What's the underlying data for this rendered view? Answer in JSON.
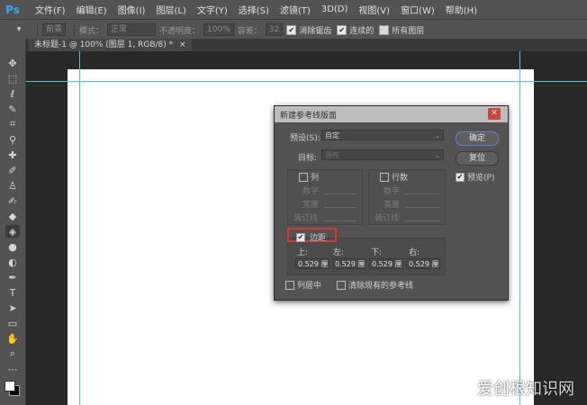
{
  "app": {
    "logo": "Ps"
  },
  "menu": {
    "items": [
      "文件(F)",
      "编辑(E)",
      "图像(I)",
      "图层(L)",
      "文字(Y)",
      "选择(S)",
      "滤镜(T)",
      "3D(D)",
      "视图(V)",
      "窗口(W)",
      "帮助(H)"
    ]
  },
  "options": {
    "mode_source": "前景",
    "mode_label": "模式：",
    "mode_value": "正常",
    "opacity_label": "不透明度：",
    "opacity_value": "100%",
    "tolerance_label": "容差：",
    "tolerance_value": "32",
    "antialias": "消除锯齿",
    "contiguous": "连续的",
    "all_layers": "所有图层"
  },
  "document": {
    "tab_title": "未标题-1 @ 100% (图层 1, RGB/8) *"
  },
  "toolbar": {
    "tools": [
      "move-tool-icon",
      "marquee-tool-icon",
      "lasso-tool-icon",
      "quick-select-tool-icon",
      "crop-tool-icon",
      "eyedropper-tool-icon",
      "healing-brush-tool-icon",
      "brush-tool-icon",
      "clone-stamp-tool-icon",
      "history-brush-tool-icon",
      "eraser-tool-icon",
      "paint-bucket-tool-icon",
      "blur-tool-icon",
      "dodge-tool-icon",
      "pen-tool-icon",
      "type-tool-icon",
      "path-select-tool-icon",
      "rectangle-tool-icon",
      "hand-tool-icon",
      "zoom-tool-icon",
      "more-tools-icon"
    ],
    "foreground_color": "#ffffff",
    "background_color": "#000000"
  },
  "dialog": {
    "title": "新建参考线版面",
    "preset_label": "预设(S):",
    "preset_value": "自定",
    "target_label": "目标:",
    "target_value": "画布",
    "columns_label": "列",
    "rows_label": "行数",
    "number_label": "数字",
    "width_label": "宽度",
    "height_label": "高度",
    "gutter_label": "装订线",
    "margin_label": "边距",
    "margin_checked": true,
    "top_label": "上:",
    "left_label": "左:",
    "bottom_label": "下:",
    "right_label": "右:",
    "top_value": "0.529 厘米",
    "left_value": "0.529 厘米",
    "bottom_value": "0.529 厘米",
    "right_value": "0.529 厘米",
    "center_columns": "列居中",
    "clear_guides": "清除现有的参考线",
    "ok_button": "确定",
    "reset_button": "复位",
    "preview_label": "预览(P)",
    "highlight_color": "#d9362f"
  },
  "watermark": {
    "text": "爱创根知识网"
  },
  "colors": {
    "guide": "#4fc8d6",
    "panel": "#535353",
    "workspace": "#282828"
  }
}
